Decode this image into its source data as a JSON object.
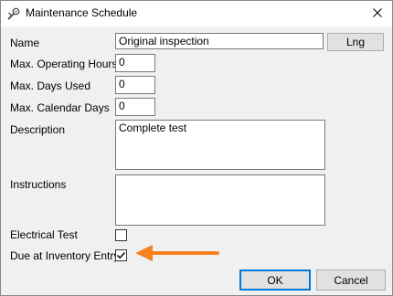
{
  "window": {
    "title": "Maintenance Schedule",
    "app_icon": "wrench-gear-icon",
    "close_icon": "close-icon"
  },
  "form": {
    "name_label": "Name",
    "name_value": "Original inspection",
    "lng_button": "Lng",
    "max_hours_label": "Max. Operating Hours",
    "max_hours_value": "0",
    "max_days_used_label": "Max. Days Used",
    "max_days_used_value": "0",
    "max_calendar_label": "Max. Calendar Days",
    "max_calendar_value": "0",
    "description_label": "Description",
    "description_value": "Complete test",
    "instructions_label": "Instructions",
    "instructions_value": "",
    "electrical_label": "Electrical Test",
    "electrical_checked": false,
    "inventory_label": "Due at Inventory Entry",
    "inventory_checked": true
  },
  "buttons": {
    "ok": "OK",
    "cancel": "Cancel"
  },
  "annotation": {
    "arrow_color": "#f5821f",
    "arrow_icon": "arrow-left-icon"
  }
}
